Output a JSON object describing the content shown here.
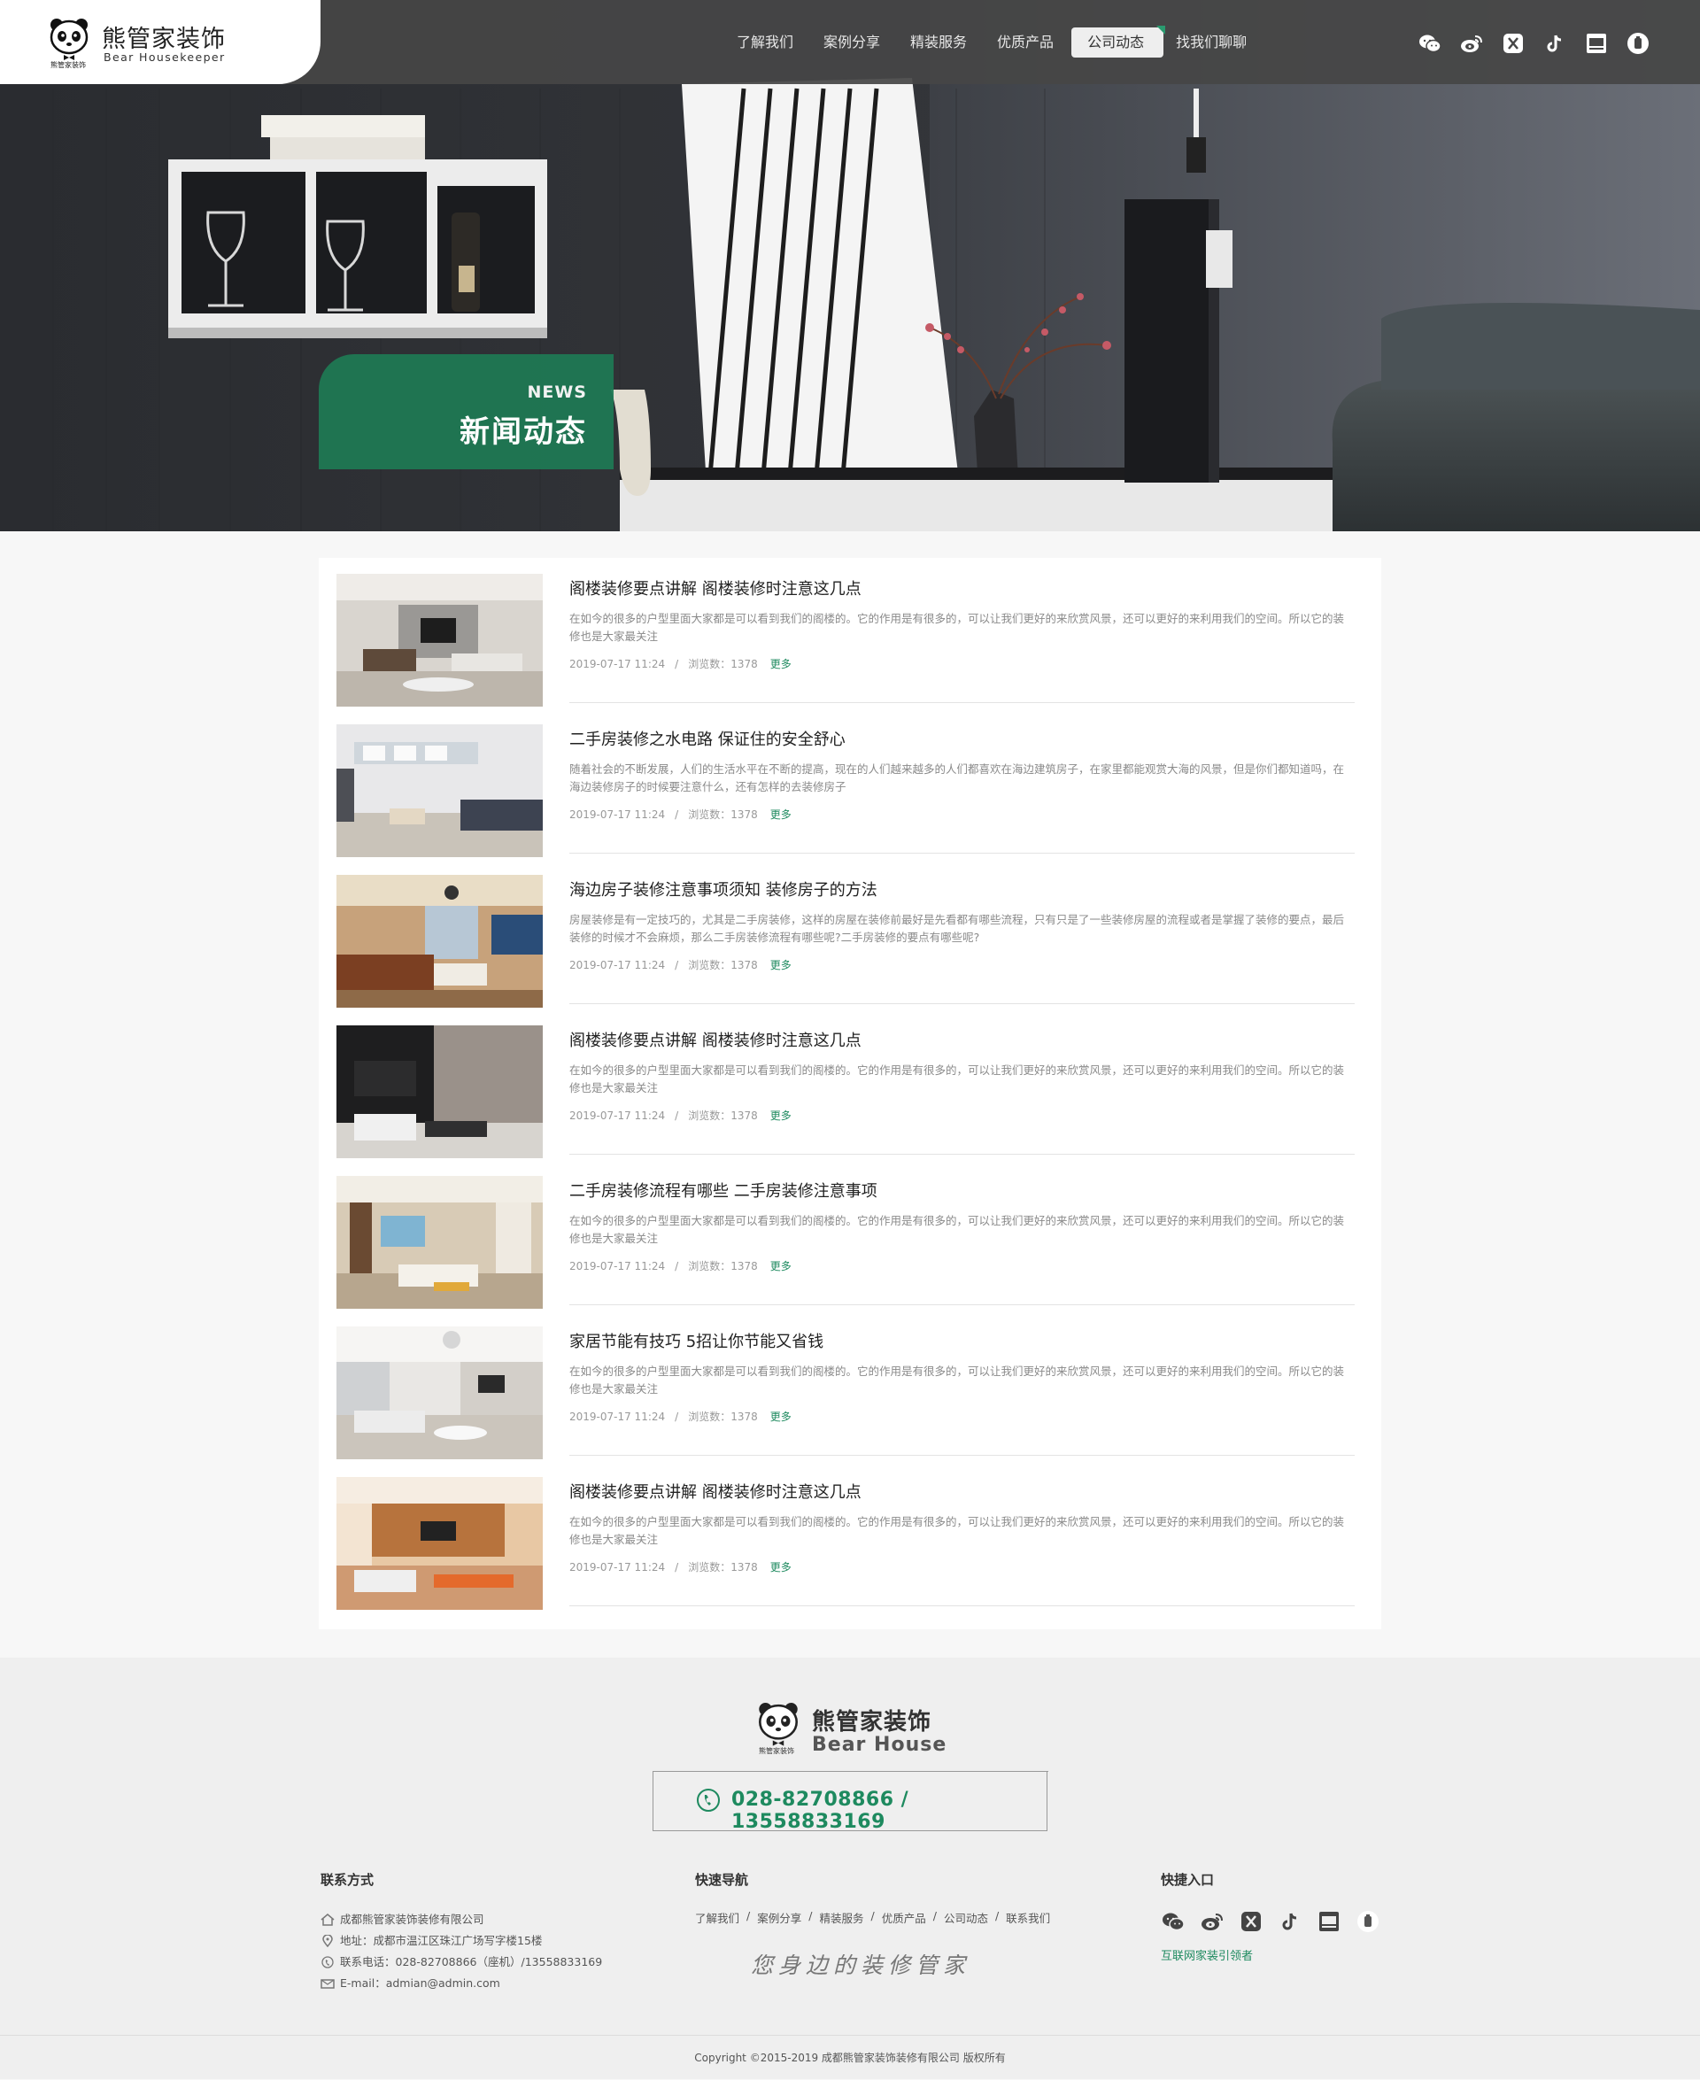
{
  "brand": {
    "name_cn": "熊管家装饰",
    "name_en": "Bear Housekeeper",
    "logo_caption": "熊管家装饰"
  },
  "nav": {
    "items": [
      {
        "label": "了解我们"
      },
      {
        "label": "案例分享"
      },
      {
        "label": "精装服务"
      },
      {
        "label": "优质产品"
      },
      {
        "label": "公司动态",
        "active": true
      },
      {
        "label": "找我们聊聊"
      }
    ]
  },
  "social_icons": [
    "wechat-icon",
    "weibo-icon",
    "app-icon",
    "douyin-icon",
    "zhaohu-icon",
    "pinduoduo-icon"
  ],
  "hero": {
    "badge_en": "NEWS",
    "badge_cn": "新闻动态"
  },
  "news": {
    "date_label": "2019-07-17 11:24",
    "views_label": "浏览数：1378",
    "more_label": "更多",
    "items": [
      {
        "title": "阁楼装修要点讲解 阁楼装修时注意这几点",
        "desc": "在如今的很多的户型里面大家都是可以看到我们的阁楼的。它的作用是有很多的，可以让我们更好的来欣赏风景，还可以更好的来利用我们的空间。所以它的装修也是大家最关注",
        "date": "2019-07-17 11:24",
        "views": "浏览数：1378"
      },
      {
        "title": "二手房装修之水电路 保证住的安全舒心",
        "desc": "随着社会的不断发展，人们的生活水平在不断的提高，现在的人们越来越多的人们都喜欢在海边建筑房子，在家里都能观赏大海的风景，但是你们都知道吗，在海边装修房子的时候要注意什么，还有怎样的去装修房子",
        "date": "2019-07-17 11:24",
        "views": "浏览数：1378"
      },
      {
        "title": "海边房子装修注意事项须知 装修房子的方法",
        "desc": "房屋装修是有一定技巧的，尤其是二手房装修，这样的房屋在装修前最好是先看都有哪些流程，只有只是了一些装修房屋的流程或者是掌握了装修的要点，最后装修的时候才不会麻烦，那么二手房装修流程有哪些呢?二手房装修的要点有哪些呢?",
        "date": "2019-07-17 11:24",
        "views": "浏览数：1378"
      },
      {
        "title": "阁楼装修要点讲解 阁楼装修时注意这几点",
        "desc": "在如今的很多的户型里面大家都是可以看到我们的阁楼的。它的作用是有很多的，可以让我们更好的来欣赏风景，还可以更好的来利用我们的空间。所以它的装修也是大家最关注",
        "date": "2019-07-17 11:24",
        "views": "浏览数：1378"
      },
      {
        "title": "二手房装修流程有哪些 二手房装修注意事项",
        "desc": "在如今的很多的户型里面大家都是可以看到我们的阁楼的。它的作用是有很多的，可以让我们更好的来欣赏风景，还可以更好的来利用我们的空间。所以它的装修也是大家最关注",
        "date": "2019-07-17 11:24",
        "views": "浏览数：1378"
      },
      {
        "title": "家居节能有技巧 5招让你节能又省钱",
        "desc": "在如今的很多的户型里面大家都是可以看到我们的阁楼的。它的作用是有很多的，可以让我们更好的来欣赏风景，还可以更好的来利用我们的空间。所以它的装修也是大家最关注",
        "date": "2019-07-17 11:24",
        "views": "浏览数：1378"
      },
      {
        "title": "阁楼装修要点讲解 阁楼装修时注意这几点",
        "desc": "在如今的很多的户型里面大家都是可以看到我们的阁楼的。它的作用是有很多的，可以让我们更好的来欣赏风景，还可以更好的来利用我们的空间。所以它的装修也是大家最关注",
        "date": "2019-07-17 11:24",
        "views": "浏览数：1378"
      }
    ]
  },
  "footer": {
    "logo_cn": "熊管家装饰",
    "logo_en": "Bear House",
    "logo_caption": "熊管家装饰",
    "phone": "028-82708866 / 13558833169",
    "contact_title": "联系方式",
    "contact": {
      "company": "成都熊管家装饰装修有限公司",
      "address": "地址：成都市温江区珠江广场写字楼15楼",
      "tel": "联系电话：028-82708866（座机）/13558833169",
      "email": "E-mail：admian@admin.com"
    },
    "nav_title": "快速导航",
    "nav_links": [
      "了解我们",
      "案例分享",
      "精装服务",
      "优质产品",
      "公司动态",
      "联系我们"
    ],
    "slogan": "您身边的装修管家",
    "quick_title": "快捷入口",
    "quick_link": "互联网家装引领者",
    "copyright": "Copyright ©2015-2019   成都熊管家装饰装修有限公司 版权所有"
  },
  "colors": {
    "accent": "#1e8a5f",
    "header_bg": "#464646",
    "footer_bg": "#efefef"
  }
}
